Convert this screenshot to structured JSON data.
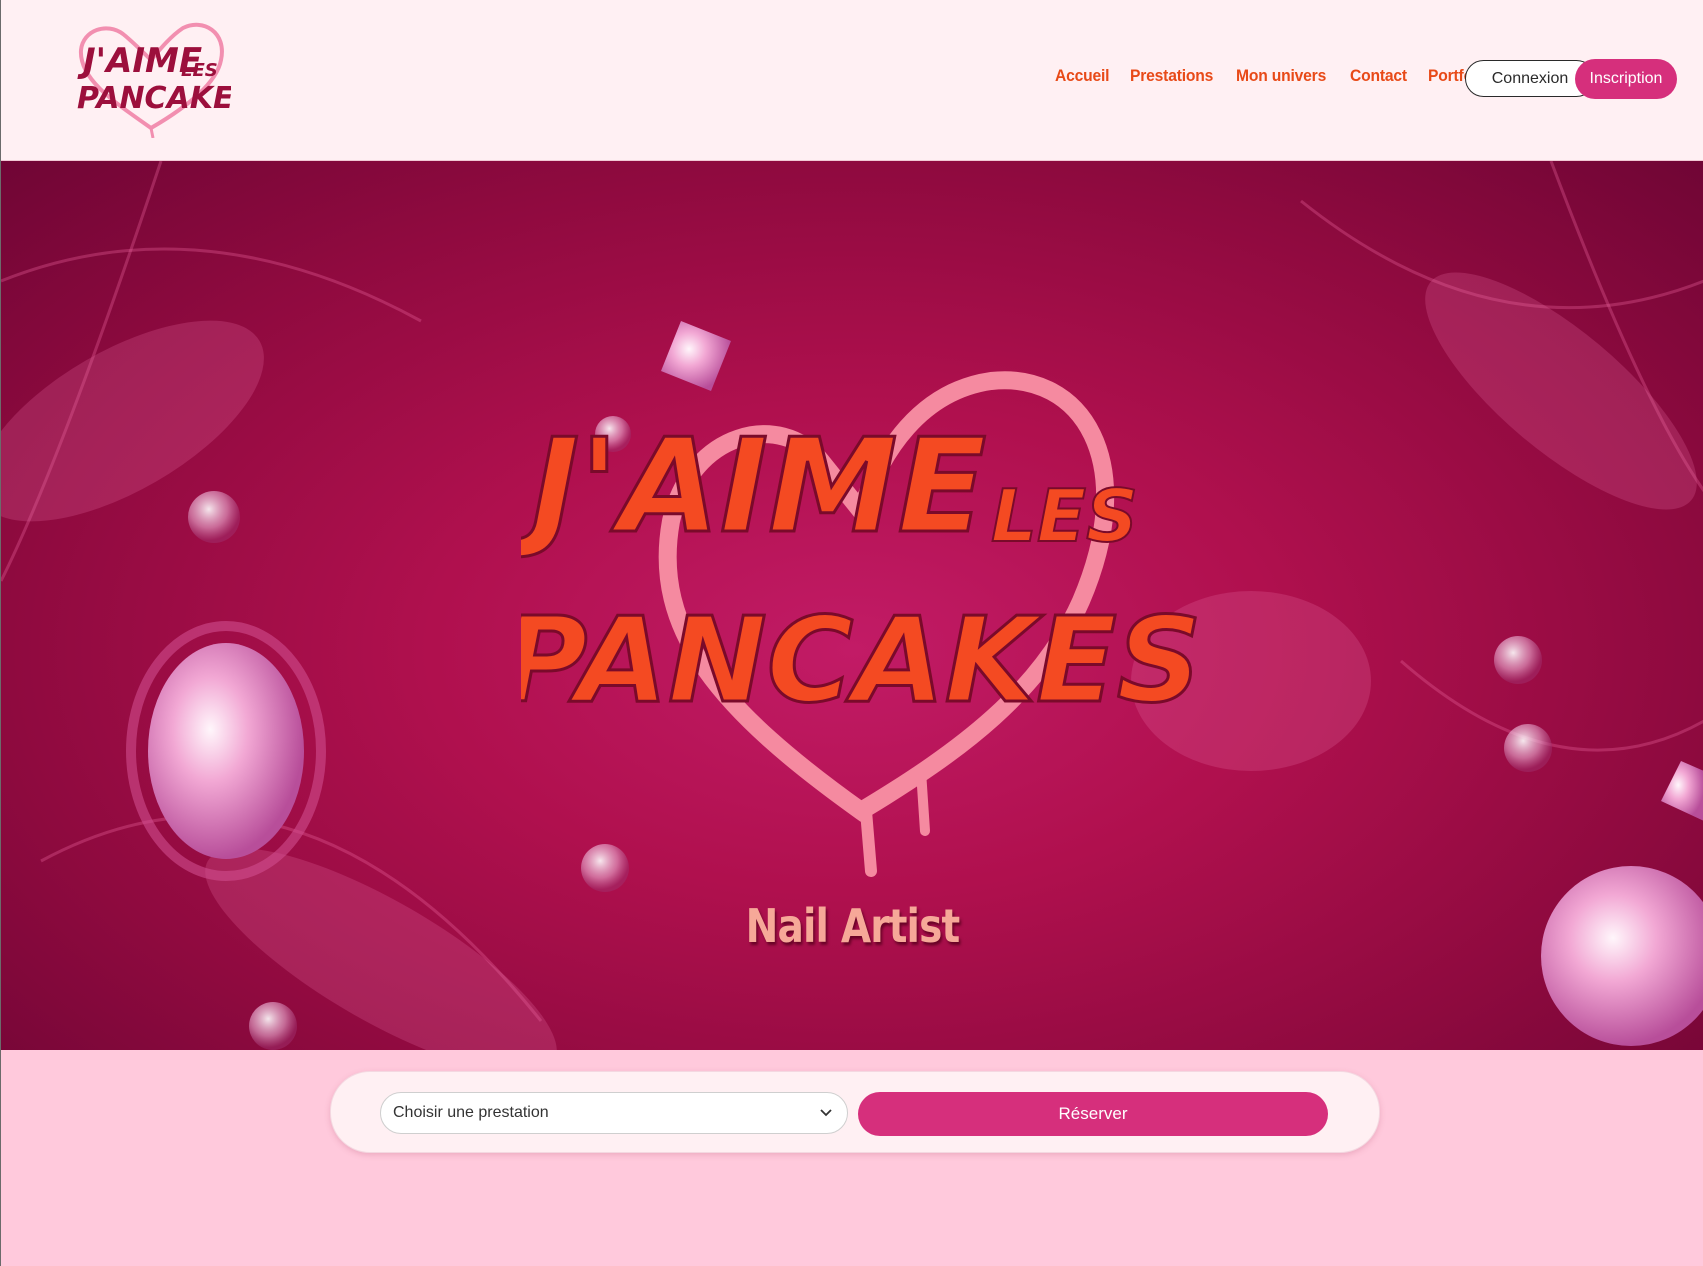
{
  "brand": {
    "logo_line1": "J'AIME",
    "logo_small": "LES",
    "logo_line2": "PANCAKES"
  },
  "nav": {
    "items": [
      {
        "label": "Accueil"
      },
      {
        "label": "Prestations"
      },
      {
        "label": "Mon univers"
      },
      {
        "label": "Contact"
      },
      {
        "label": "Portfolio"
      }
    ],
    "login_label": "Connexion",
    "signup_label": "Inscription"
  },
  "hero": {
    "subtitle": "Nail Artist"
  },
  "booking": {
    "select_value": "Choisir une prestation",
    "reserve_label": "Réserver"
  },
  "colors": {
    "accent": "#d62f7c",
    "nav_text": "#e84a18",
    "header_bg": "#fff0f3",
    "page_bg": "#ffc9dc"
  }
}
